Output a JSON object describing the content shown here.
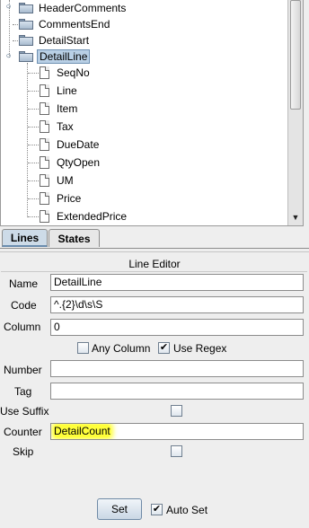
{
  "tree": {
    "top_nodes": [
      {
        "label": "HeaderComments",
        "type": "folder",
        "toggle": "+"
      },
      {
        "label": "CommentsEnd",
        "type": "folder"
      },
      {
        "label": "DetailStart",
        "type": "folder"
      },
      {
        "label": "DetailLine",
        "type": "folder",
        "toggle": "-",
        "selected": true
      }
    ],
    "children": [
      "SeqNo",
      "Line",
      "Item",
      "Tax",
      "DueDate",
      "QtyOpen",
      "UM",
      "Price",
      "ExtendedPrice"
    ]
  },
  "tabs": [
    {
      "label": "Lines",
      "active": true
    },
    {
      "label": "States",
      "active": false
    }
  ],
  "editor": {
    "title": "Line Editor",
    "name_label": "Name",
    "name_value": "DetailLine",
    "code_label": "Code",
    "code_value": "^.{2}\\d\\s\\S",
    "column_label": "Column",
    "column_value": "0",
    "any_column_label": "Any Column",
    "any_column_checked": false,
    "use_regex_label": "Use Regex",
    "use_regex_checked": true,
    "number_label": "Number",
    "number_value": "",
    "tag_label": "Tag",
    "tag_value": "",
    "use_suffix_label": "Use Suffix",
    "use_suffix_checked": false,
    "counter_label": "Counter",
    "counter_value": "DetailCount",
    "skip_label": "Skip",
    "skip_checked": false,
    "set_label": "Set",
    "auto_set_label": "Auto Set",
    "auto_set_checked": true
  },
  "colors": {
    "selection": "#b8cfe5",
    "highlight": "#ffff3a",
    "active_tab": "#cddbe8"
  }
}
